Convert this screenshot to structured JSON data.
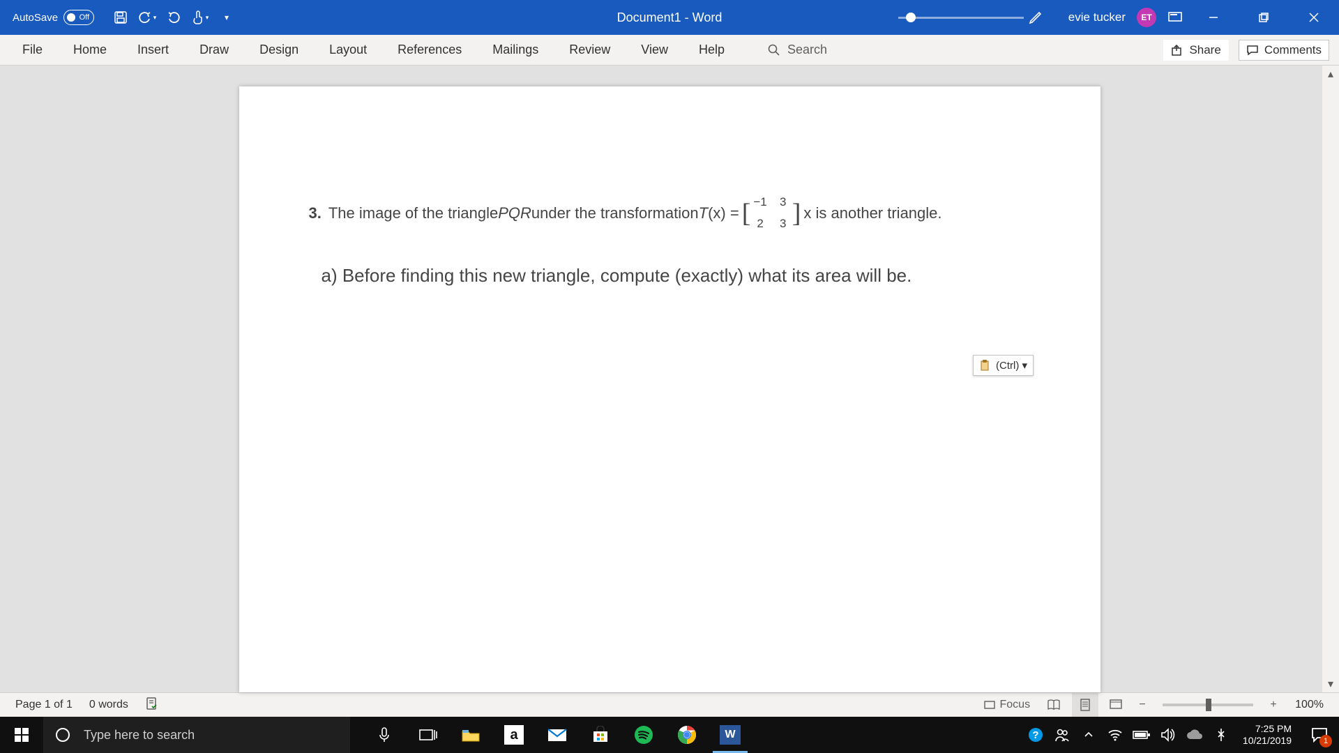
{
  "titlebar": {
    "autosave_label": "AutoSave",
    "autosave_state": "Off",
    "doc_title": "Document1  -  Word",
    "user_name": "evie tucker",
    "user_initials": "ET"
  },
  "ribbon": {
    "tabs": [
      "File",
      "Home",
      "Insert",
      "Draw",
      "Design",
      "Layout",
      "References",
      "Mailings",
      "Review",
      "View",
      "Help"
    ],
    "search_placeholder": "Search",
    "share_label": "Share",
    "comments_label": "Comments"
  },
  "document": {
    "q_number": "3.",
    "q_text_a": "The image of the triangle ",
    "q_pqr": "PQR",
    "q_text_b": " under the transformation  ",
    "q_T": "T",
    "q_paren": "(x) =",
    "matrix": {
      "r1": [
        "−1",
        "3"
      ],
      "r2": [
        "2",
        "3"
      ]
    },
    "q_text_c": "x  is another triangle.",
    "sub_a": "a) Before finding this new triangle, compute (exactly) what its area will be.",
    "paste_ctrl": "(Ctrl) ▾"
  },
  "statusbar": {
    "page": "Page 1 of 1",
    "words": "0 words",
    "focus": "Focus",
    "zoom": "100%"
  },
  "taskbar": {
    "search_placeholder": "Type here to search",
    "time": "7:25 PM",
    "date": "10/21/2019",
    "notif_count": "1"
  }
}
